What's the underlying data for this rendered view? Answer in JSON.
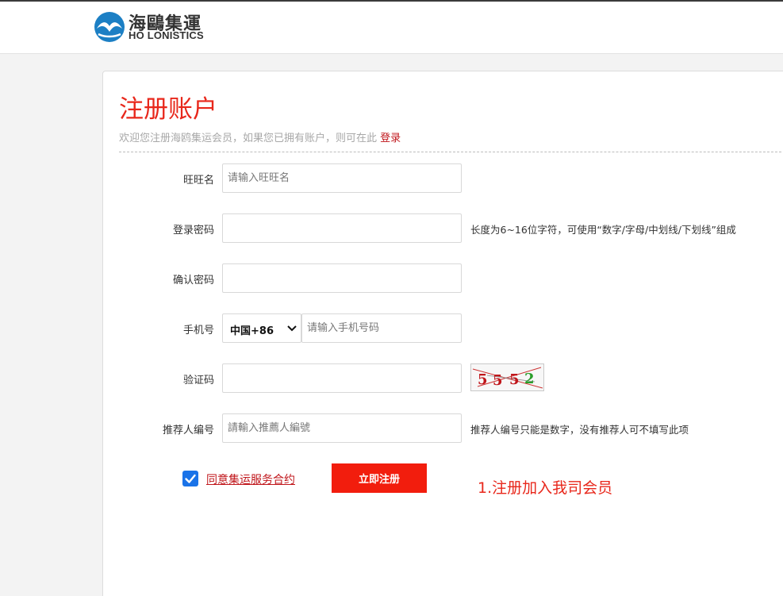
{
  "logo": {
    "name_cn": "海鷗集運",
    "name_en": "HO LONISTICS"
  },
  "page": {
    "title": "注册账户",
    "subtitle": "欢迎您注册海鸥集运会员，如果您已拥有账户，则可在此",
    "login_link": "登录"
  },
  "form": {
    "wangwang": {
      "label": "旺旺名",
      "placeholder": "请输入旺旺名",
      "value": ""
    },
    "password": {
      "label": "登录密码",
      "value": "",
      "hint": "长度为6~16位字符，可使用“数字/字母/中划线/下划线”组成"
    },
    "confirm": {
      "label": "确认密码",
      "value": ""
    },
    "phone": {
      "label": "手机号",
      "country_code": "中国+86",
      "placeholder": "请输入手机号码",
      "value": ""
    },
    "captcha": {
      "label": "验证码",
      "value": "",
      "image_text": "5552"
    },
    "referrer": {
      "label": "推荐人编号",
      "placeholder": "請輸入推薦人編號",
      "value": "",
      "hint": "推荐人编号只能是数字，没有推荐人可不填写此项"
    },
    "agree": {
      "checked": true,
      "label": "同意集运服务合约"
    },
    "submit_label": "立即注册"
  },
  "annotation": "1.注册加入我司会员",
  "colors": {
    "accent": "#e8271b",
    "button": "#f21d0d",
    "checkbox": "#1a73e8",
    "link": "#c0161b"
  }
}
